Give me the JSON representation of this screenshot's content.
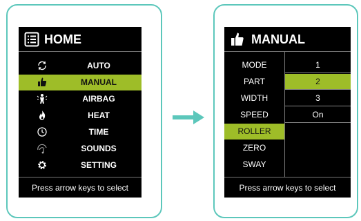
{
  "colors": {
    "frame": "#5cc7bb",
    "screen": "#000000",
    "highlight": "#9ebd28",
    "arrow": "#5cc7bb"
  },
  "home": {
    "title": "HOME",
    "title_icon": "list-menu-icon",
    "items": [
      {
        "label": "AUTO",
        "icon": "auto-cycle-icon"
      },
      {
        "label": "MANUAL",
        "icon": "thumb-icon",
        "selected": true
      },
      {
        "label": "AIRBAG",
        "icon": "airbag-body-icon"
      },
      {
        "label": "HEAT",
        "icon": "flame-icon"
      },
      {
        "label": "TIME",
        "icon": "clock-icon"
      },
      {
        "label": "SOUNDS",
        "icon": "sound-icon"
      },
      {
        "label": "SETTING",
        "icon": "gear-icon"
      }
    ],
    "footer": "Press arrow keys to select"
  },
  "manual": {
    "title": "MANUAL",
    "title_icon": "thumb-icon",
    "params": [
      "MODE",
      "PART",
      "WIDTH",
      "SPEED",
      "ROLLER",
      "ZERO",
      "SWAY"
    ],
    "selected_param": "ROLLER",
    "values": [
      "1",
      "2",
      "3",
      "On"
    ],
    "selected_value": "2",
    "footer": "Press arrow keys to select"
  }
}
